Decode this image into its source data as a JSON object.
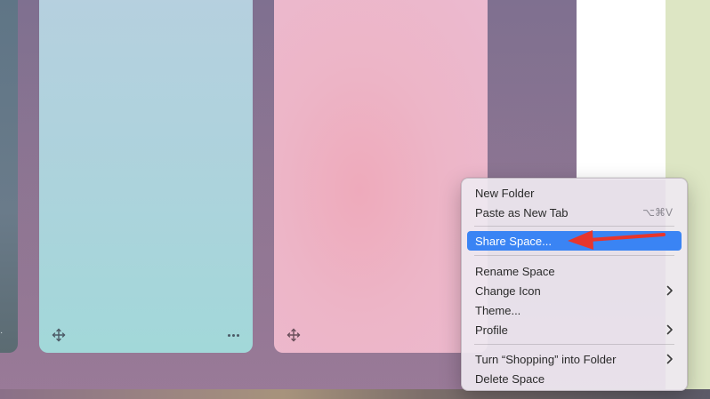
{
  "colors": {
    "accent": "#3a84f4",
    "annotation": "#e8352b",
    "card_blue": "#acd3dc",
    "card_pink": "#edb5c7"
  },
  "cards": [
    {
      "name": "space-card-blue",
      "icons": [
        "move-icon",
        "more-icon"
      ]
    },
    {
      "name": "space-card-pink",
      "icons": [
        "move-icon",
        "more-icon"
      ]
    }
  ],
  "context_menu": {
    "items": [
      {
        "label": "New Folder",
        "shortcut": "",
        "submenu": false
      },
      {
        "label": "Paste as New Tab",
        "shortcut": "⌥⌘V",
        "submenu": false
      },
      {
        "label": "Share Space...",
        "shortcut": "",
        "submenu": false,
        "selected": true
      },
      {
        "label": "Rename Space",
        "shortcut": "",
        "submenu": false
      },
      {
        "label": "Change Icon",
        "shortcut": "",
        "submenu": true
      },
      {
        "label": "Theme...",
        "shortcut": "",
        "submenu": false
      },
      {
        "label": "Profile",
        "shortcut": "",
        "submenu": true
      },
      {
        "label": "Turn “Shopping” into Folder",
        "shortcut": "",
        "submenu": true
      },
      {
        "label": "Delete Space",
        "shortcut": "",
        "submenu": false
      }
    ]
  }
}
